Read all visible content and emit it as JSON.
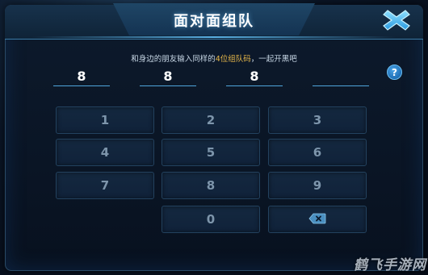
{
  "header": {
    "title": "面对面组队",
    "close_icon": "close-x-icon"
  },
  "instruction": {
    "before": "和身边的朋友输入同样的",
    "highlight": "4位组队码",
    "after": "，一起开黑吧"
  },
  "help": {
    "label": "?",
    "icon": "help-icon"
  },
  "code_slots": [
    "8",
    "8",
    "8",
    ""
  ],
  "keypad": {
    "keys": [
      "1",
      "2",
      "3",
      "4",
      "5",
      "6",
      "7",
      "8",
      "9",
      "0"
    ],
    "backspace_icon": "backspace-icon"
  },
  "watermark": "鹤飞手游网",
  "colors": {
    "accent": "#4ea4dc",
    "highlight": "#e8b84a",
    "key_text": "#7d95ab",
    "panel": "#0d1a2c"
  }
}
